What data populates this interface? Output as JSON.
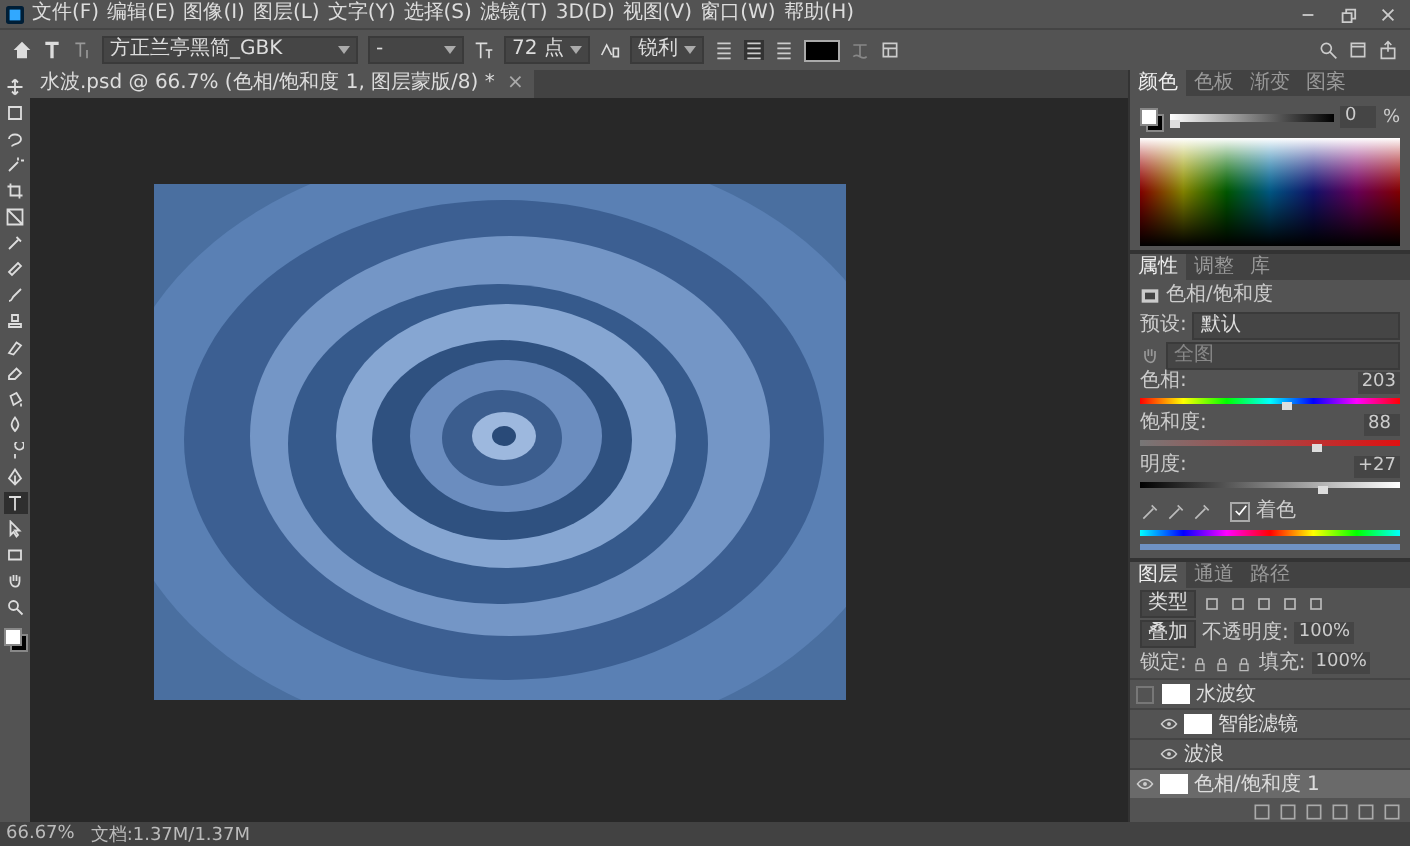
{
  "menu": [
    "文件(F)",
    "编辑(E)",
    "图像(I)",
    "图层(L)",
    "文字(Y)",
    "选择(S)",
    "滤镜(T)",
    "3D(D)",
    "视图(V)",
    "窗口(W)",
    "帮助(H)"
  ],
  "options": {
    "font": "方正兰亭黑简_GBK",
    "style": "-",
    "size": "72 点",
    "antialias": "锐利",
    "aligns": [
      {
        "selected": false
      },
      {
        "selected": true
      },
      {
        "selected": false
      }
    ]
  },
  "document_tab": {
    "title": "水波.psd @ 66.7% (色相/饱和度 1, 图层蒙版/8) *",
    "close": "×"
  },
  "tools": [
    {
      "kind": "move",
      "selected": false
    },
    {
      "kind": "marquee",
      "selected": false
    },
    {
      "kind": "lasso",
      "selected": false
    },
    {
      "kind": "wand",
      "selected": false
    },
    {
      "kind": "crop",
      "selected": false
    },
    {
      "kind": "frame",
      "selected": false
    },
    {
      "kind": "eyedropper",
      "selected": false
    },
    {
      "kind": "heal",
      "selected": false
    },
    {
      "kind": "brush",
      "selected": false
    },
    {
      "kind": "stamp",
      "selected": false
    },
    {
      "kind": "history",
      "selected": false
    },
    {
      "kind": "eraser",
      "selected": false
    },
    {
      "kind": "bucket",
      "selected": false
    },
    {
      "kind": "blur",
      "selected": false
    },
    {
      "kind": "dodge",
      "selected": false
    },
    {
      "kind": "pen",
      "selected": false
    },
    {
      "kind": "type",
      "selected": true
    },
    {
      "kind": "select",
      "selected": false
    },
    {
      "kind": "shape",
      "selected": false
    },
    {
      "kind": "hand",
      "selected": false
    },
    {
      "kind": "zoom",
      "selected": false
    }
  ],
  "color_panel": {
    "tabs": [
      {
        "label": "颜色",
        "selected": true
      },
      {
        "label": "色板",
        "selected": false
      },
      {
        "label": "渐变",
        "selected": false
      },
      {
        "label": "图案",
        "selected": false
      }
    ],
    "tone": {
      "level": 0.02,
      "value": "0"
    },
    "unit": "%"
  },
  "properties_panel": {
    "tabs": [
      {
        "label": "属性",
        "selected": true
      },
      {
        "label": "调整",
        "selected": false
      },
      {
        "label": "库",
        "selected": false
      }
    ],
    "title": "色相/饱和度",
    "preset_label": "预设:",
    "preset": "默认",
    "channel": "全图",
    "sliders": [
      {
        "kind": "hue",
        "label": "色相:",
        "value": "203",
        "level": 0.56
      },
      {
        "kind": "saturation",
        "label": "饱和度:",
        "value": "88",
        "level": 0.68
      },
      {
        "kind": "lightness",
        "label": "明度:",
        "value": "+27",
        "level": 0.7
      }
    ],
    "colorize": {
      "label": "着色",
      "checked": true
    }
  },
  "layers_panel": {
    "tabs": [
      {
        "label": "图层",
        "selected": true
      },
      {
        "label": "通道",
        "selected": false
      },
      {
        "label": "路径",
        "selected": false
      }
    ],
    "filter": "类型",
    "blend": "叠加",
    "opacity_label": "不透明度:",
    "opacity": "100%",
    "lock_label": "锁定:",
    "fill_label": "填充:",
    "fill": "100%",
    "layers": [
      {
        "name": "水波纹",
        "kind": "smart",
        "visible": false,
        "selected": false
      },
      {
        "name": "智能滤镜",
        "kind": "filtermask",
        "visible": true,
        "selected": false
      },
      {
        "name": "波浪",
        "kind": "filter",
        "visible": true,
        "selected": false
      },
      {
        "name": "色相/饱和度 1",
        "kind": "adjustment",
        "visible": true,
        "selected": true
      }
    ]
  },
  "status_bar": {
    "zoom": "66.67%",
    "info": "文档:1.37M/1.37M"
  }
}
